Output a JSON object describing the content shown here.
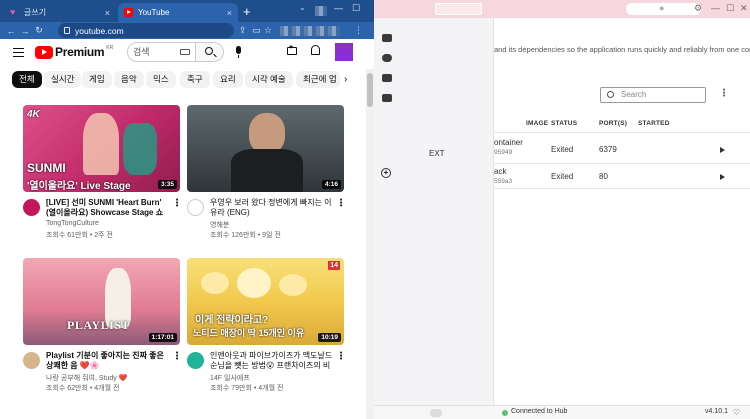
{
  "chrome": {
    "tabs": [
      {
        "label": "글쓰기",
        "icon": "heart-icon"
      },
      {
        "label": "YouTube",
        "icon": "youtube-icon"
      }
    ],
    "url": "youtube.com",
    "tab_close_glyph": "×",
    "new_tab_glyph": "+"
  },
  "youtube": {
    "brand": "Premium",
    "region": "KR",
    "search_placeholder": "검색",
    "chips": [
      "전체",
      "실시간",
      "게임",
      "음악",
      "믹스",
      "축구",
      "요리",
      "시각 예술",
      "최근에 업"
    ],
    "videos": [
      {
        "title": "[LIVE] 선미 SUNMI 'Heart Burn' (열이올라요) Showcase Stage 쇼케이스 무대",
        "channel": "TongTongCulture",
        "meta": "조회수 61만회 • 2주 전",
        "duration": "3:35",
        "thumb_text_1": "SUNMI",
        "thumb_text_2": "'열이올라요' Live Stage",
        "badge": "4K",
        "colors": {
          "bg": "#d63b78",
          "avatar": "#c2185b"
        }
      },
      {
        "title": "우영우 보러 왔다 정변에게 빠지는 이유라 (ENG)",
        "channel": "영해분",
        "meta": "조회수 126만회 • 9일 전",
        "duration": "4:16",
        "colors": {
          "bg": "#3c4448",
          "avatar": "#ffffff"
        }
      },
      {
        "title": "Playlist 기분이 좋아지는 진짜 좋은 상쾌한 음 ❤️🌸",
        "channel": "나랑 공부해 줘여, Study ❤️",
        "meta": "조회수 62만회 • 4개월 전",
        "duration": "1:17:01",
        "thumb_text_1": "PLAYLIST",
        "colors": {
          "bg": "#e88a9c",
          "avatar": "#d7b58a"
        }
      },
      {
        "title": "인앤아웃과 파이브가이즈가 맥도날드 순님을 뺏는 방법😮 프랜차이즈의 비",
        "channel": "14F 일사에프",
        "meta": "조회수 79만회 • 4개월 전",
        "duration": "10:19",
        "thumb_text_1": "이게 전략이라고?",
        "thumb_text_2": "노티드 매장이 딱 15개인 이유",
        "badge": "14",
        "colors": {
          "bg": "#f2c94c",
          "avatar": "#1fb39a"
        }
      }
    ]
  },
  "docker": {
    "extensions_label": "EXT",
    "description": "and its dependencies so the application runs quickly and reliably from one computing",
    "search_placeholder": "Search",
    "columns": [
      "IMAGE",
      "STATUS",
      "PORT(S)",
      "STARTED"
    ],
    "rows": [
      {
        "name": "ontainer",
        "id": "95949",
        "status": "Exited",
        "port": "6379"
      },
      {
        "name": "ack",
        "id": "559a3",
        "status": "Exited",
        "port": "80"
      }
    ],
    "hub_status": "Connected to Hub",
    "version": "v4.10.1",
    "colors": {
      "accent": "#f7d7de",
      "status_ok": "#5fbf6e"
    }
  }
}
